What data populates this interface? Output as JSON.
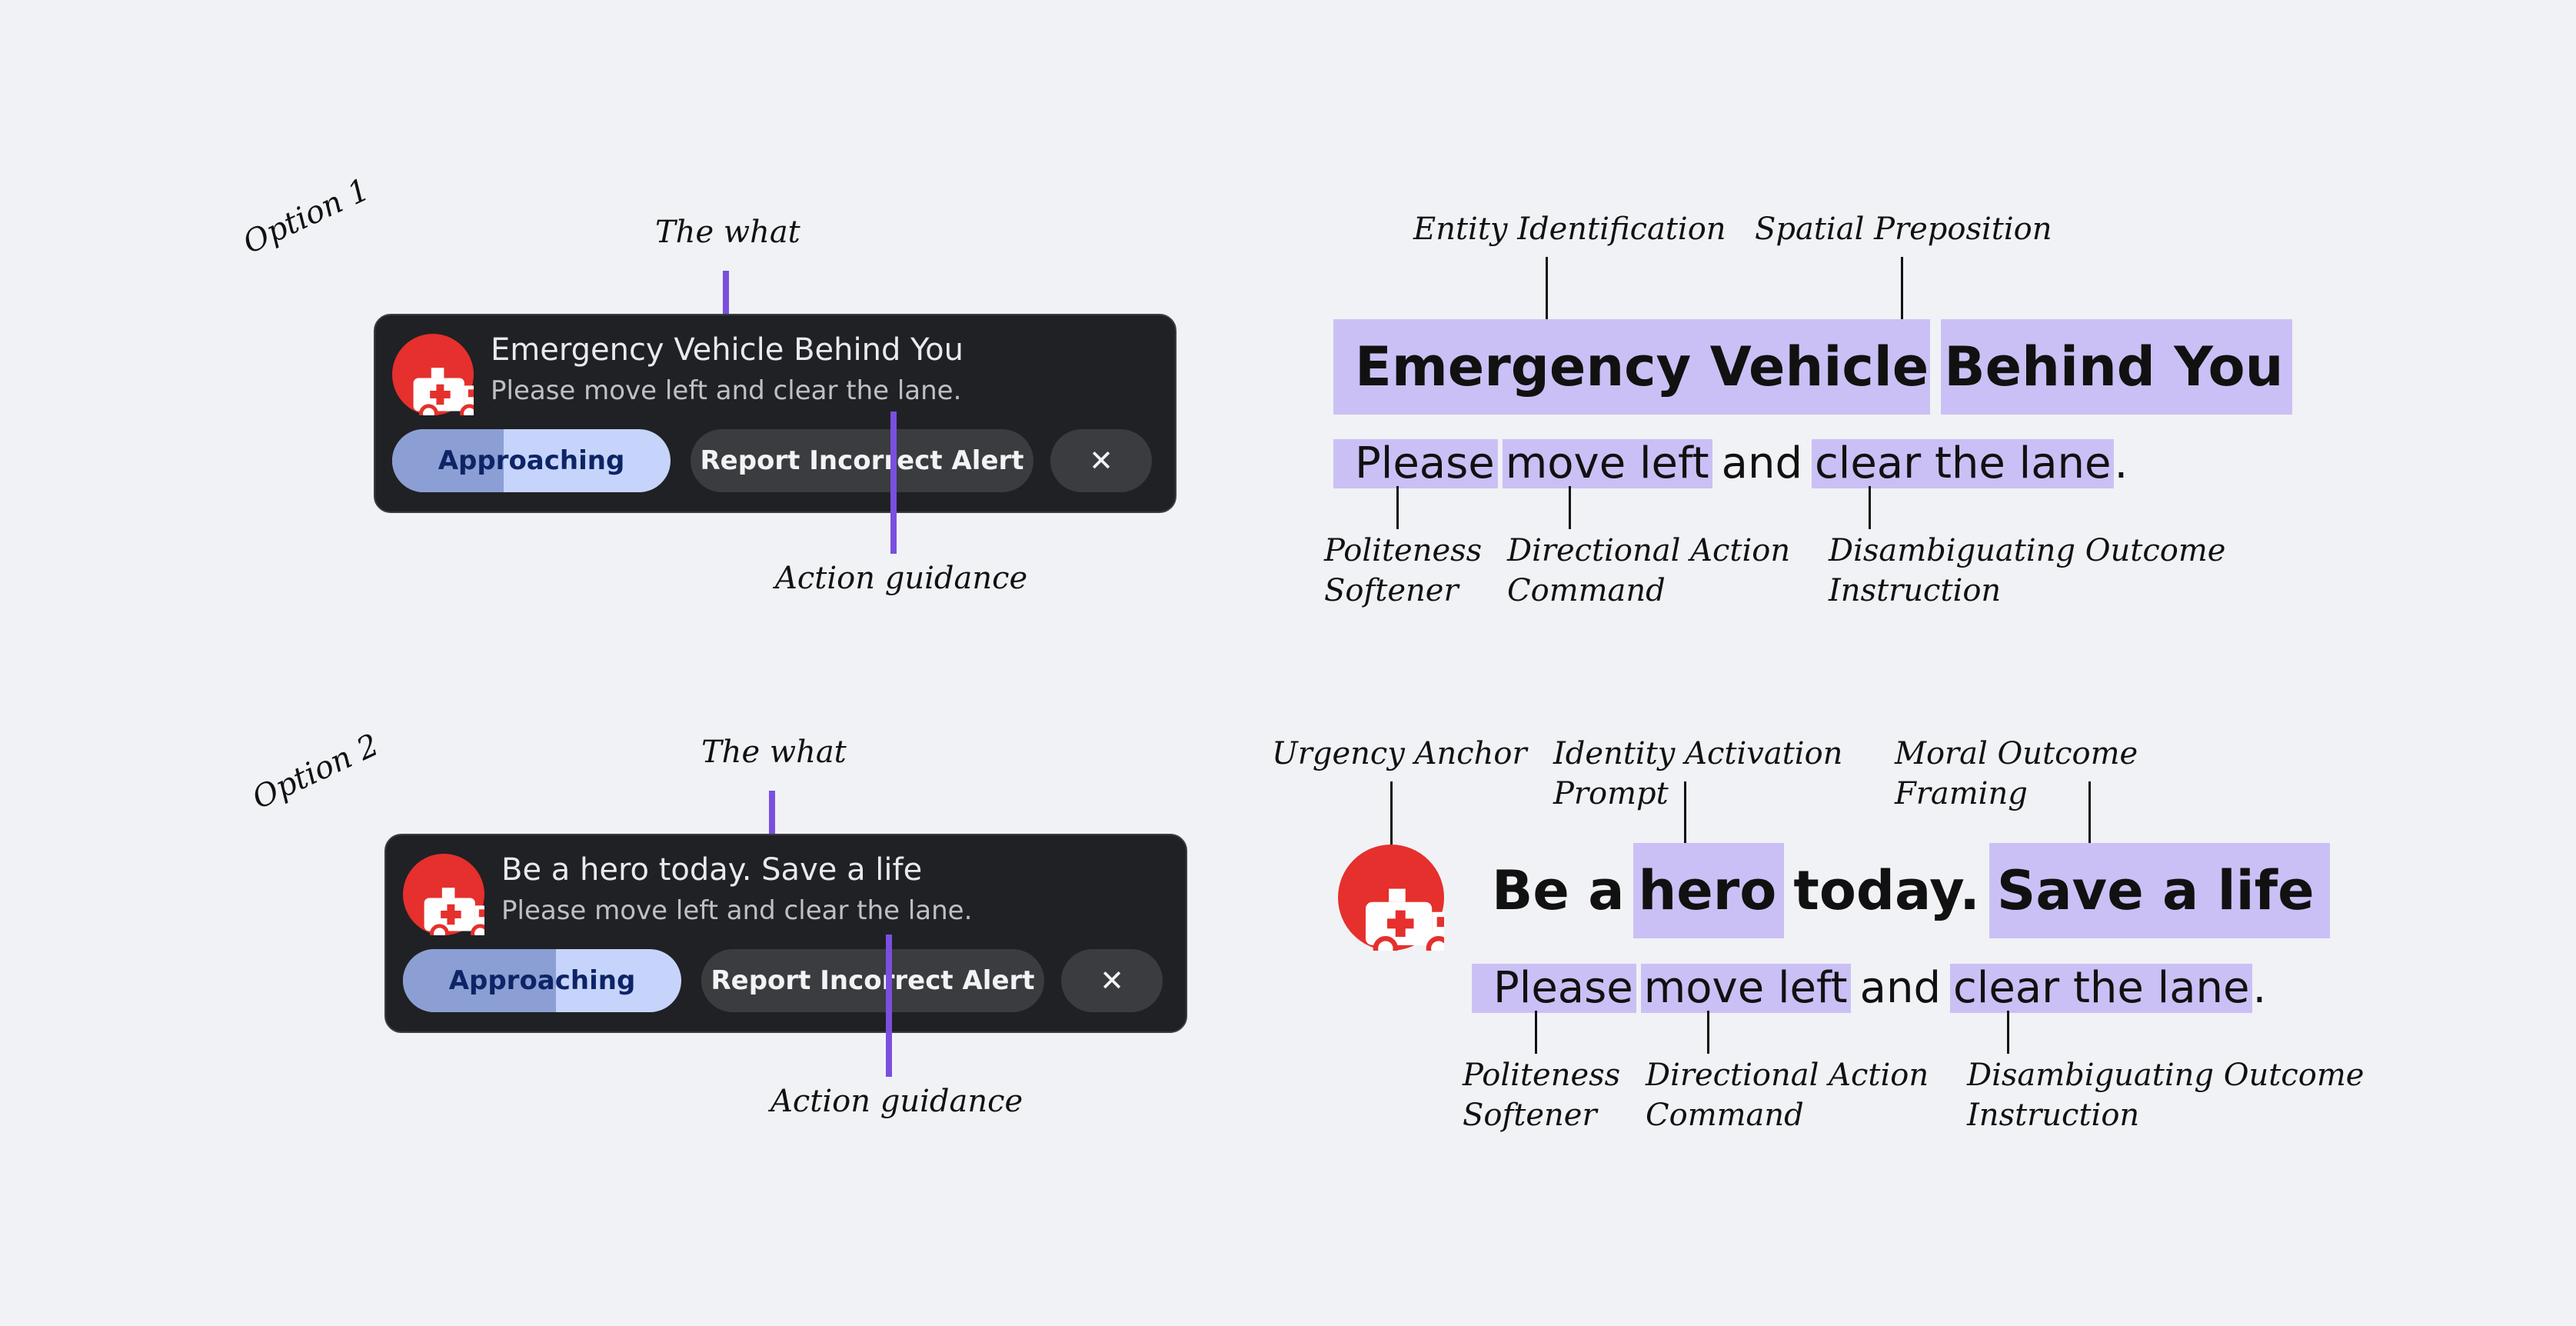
{
  "colors": {
    "background": "#f1f2f5",
    "accent_bar": "#7a4fe0",
    "highlight": "#cbc0f5",
    "alert_red": "#e5302d",
    "card": "#202124"
  },
  "option1": {
    "label": "Option 1",
    "annotations": {
      "what": "The what",
      "action": "Action guidance"
    },
    "card": {
      "icon": "ambulance-icon",
      "title": "Emergency Vehicle Behind You",
      "subtitle": "Please move left and clear the lane.",
      "approach_label": "Approaching",
      "approach_progress": 0.4,
      "report_label": "Report Incorrect Alert",
      "close_label": "✕"
    },
    "breakdown": {
      "line1": [
        "Emergency Vehicle",
        "Behind You"
      ],
      "line2": {
        "w1": "Please",
        "w2": "move left",
        "w3": "and",
        "w4": "clear the lane",
        "w5": "."
      },
      "top_labels": [
        "Entity Identification",
        "Spatial Preposition"
      ],
      "bottom_labels": [
        {
          "l1": "Politeness",
          "l2": "Softener"
        },
        {
          "l1": "Directional Action",
          "l2": "Command"
        },
        {
          "l1": "Disambiguating Outcome",
          "l2": "Instruction"
        }
      ]
    }
  },
  "option2": {
    "label": "Option 2",
    "annotations": {
      "what": "The what",
      "action": "Action guidance"
    },
    "card": {
      "icon": "ambulance-icon",
      "title": "Be a hero today. Save a life",
      "subtitle": "Please move left and clear the lane.",
      "approach_label": "Approaching",
      "approach_progress": 0.55,
      "report_label": "Report Incorrect Alert",
      "close_label": "✕"
    },
    "breakdown": {
      "line1": {
        "w1": "Be a",
        "w2": "hero",
        "w3": "today.",
        "w4": "Save a life"
      },
      "line2": {
        "w1": "Please",
        "w2": "move left",
        "w3": "and",
        "w4": "clear the lane",
        "w5": "."
      },
      "top_labels": [
        "Urgency Anchor",
        {
          "l1": "Identity Activation",
          "l2": "Prompt"
        },
        {
          "l1": "Moral Outcome",
          "l2": "Framing"
        }
      ],
      "bottom_labels": [
        {
          "l1": "Politeness",
          "l2": "Softener"
        },
        {
          "l1": "Directional Action",
          "l2": "Command"
        },
        {
          "l1": "Disambiguating Outcome",
          "l2": "Instruction"
        }
      ]
    }
  }
}
